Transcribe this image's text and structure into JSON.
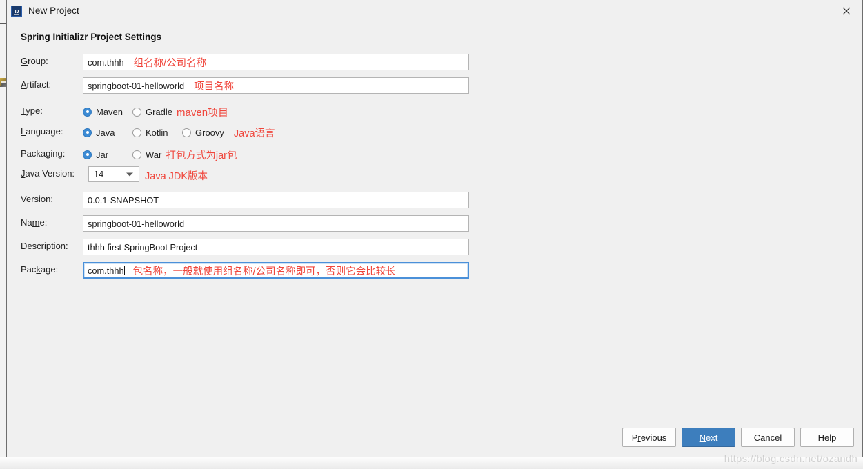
{
  "window": {
    "title": "New Project",
    "icon": "intellij-idea-icon",
    "close_label": "✕",
    "accent_blue": "#3d7ebd",
    "annotation_red": "#f0463c"
  },
  "section": {
    "title": "Spring Initializr Project Settings"
  },
  "fields": {
    "group": {
      "label_pre": "G",
      "label_mn": "",
      "label": "Group:",
      "value": "com.thhh",
      "annotation": "组名称/公司名称"
    },
    "artifact": {
      "label": "Artifact:",
      "value": "springboot-01-helloworld",
      "annotation": "项目名称"
    },
    "type": {
      "label": "Type:",
      "options": [
        "Maven",
        "Gradle"
      ],
      "selected": "Maven",
      "annotation": "maven项目"
    },
    "language": {
      "label": "Language:",
      "options": [
        "Java",
        "Kotlin",
        "Groovy"
      ],
      "selected": "Java",
      "annotation": "Java语言"
    },
    "packaging": {
      "label": "Packaging:",
      "options": [
        "Jar",
        "War"
      ],
      "selected": "Jar",
      "annotation": "打包方式为jar包"
    },
    "java_version": {
      "label": "Java Version:",
      "value": "14",
      "annotation": "Java JDK版本"
    },
    "version": {
      "label": "Version:",
      "value": "0.0.1-SNAPSHOT"
    },
    "name": {
      "label": "Name:",
      "value": "springboot-01-helloworld"
    },
    "description": {
      "label": "Description:",
      "value": "thhh first SpringBoot Project"
    },
    "package": {
      "label": "Package:",
      "value": "com.thhh",
      "focused": true,
      "annotation": "包名称，一般就使用组名称/公司名称即可，否则它会比较长"
    }
  },
  "buttons": {
    "previous": {
      "pre": "P",
      "mn": "r",
      "post": "evious",
      "label": "Previous"
    },
    "next": {
      "pre": "",
      "mn": "N",
      "post": "ext",
      "label": "Next",
      "primary": true
    },
    "cancel": {
      "label": "Cancel"
    },
    "help": {
      "label": "Help"
    }
  },
  "watermark": {
    "text": "https://blog.csdn.net/ozandh"
  }
}
